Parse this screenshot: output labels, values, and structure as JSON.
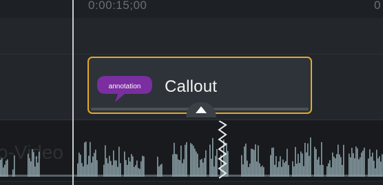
{
  "ruler": {
    "timecode": "0:00:15;00",
    "edge_label": "0"
  },
  "callout_clip": {
    "badge_label": "annotation",
    "title": "Callout",
    "badge_color": "#7a2ea0",
    "border_color": "#e3a928"
  },
  "audio_track": {
    "watermark_text": "o-Video"
  },
  "colors": {
    "track_bg": "#23272b",
    "waveform": "#8aa0a6",
    "playhead": "#c9cdd1"
  }
}
